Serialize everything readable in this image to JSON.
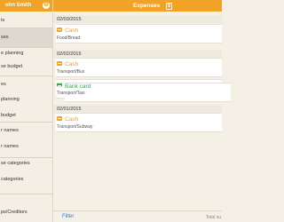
{
  "sidebar": {
    "user_name": "ohn Smith",
    "items": [
      {
        "label": "ts"
      },
      {
        "label": "ses"
      },
      {
        "label": "e planning"
      },
      {
        "label": "se budget"
      },
      {
        "label": "es"
      },
      {
        "label": "planning"
      },
      {
        "label": "budget"
      },
      {
        "label": "r names"
      },
      {
        "label": "r names"
      },
      {
        "label": "se categories"
      },
      {
        "label": "categories"
      },
      {
        "label": "ps/Creditors"
      }
    ]
  },
  "header": {
    "title": "Expenses",
    "icon": "dollar-icon"
  },
  "groups": [
    {
      "date": "02/03/2015",
      "entries": [
        {
          "method": "Cash",
          "category": "Food/Bread",
          "icon": "cash-icon"
        }
      ]
    },
    {
      "date": "02/02/2015",
      "entries": [
        {
          "method": "Cash",
          "category": "Transport/Bus",
          "icon": "cash-icon"
        },
        {
          "method": "Bank card",
          "category": "Transport/Taxi",
          "icon": "bank-card-icon"
        }
      ]
    },
    {
      "date": "02/01/2015",
      "entries": [
        {
          "method": "Cash",
          "category": "Transport/Subway",
          "icon": "cash-icon"
        }
      ]
    }
  ],
  "footer": {
    "filter_label": "Filter",
    "total_label": "Total su"
  },
  "colors": {
    "accent": "#f0a326",
    "card_green": "#3aa84a",
    "link": "#3b78c4"
  }
}
